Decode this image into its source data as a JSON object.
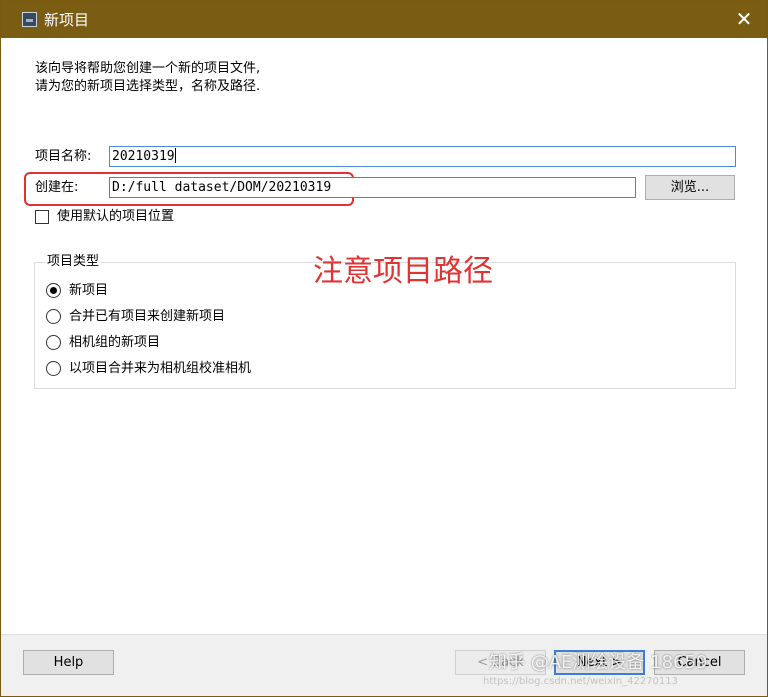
{
  "window": {
    "title": "新项目",
    "close_glyph": "✕"
  },
  "intro": {
    "text": "该向导将帮助您创建一个新的项目文件,\n请为您的新项目选择类型，名称及路径."
  },
  "form": {
    "name_label": "项目名称:",
    "name_value": "20210319",
    "location_label": "创建在:",
    "location_value": "D:/full dataset/DOM/20210319",
    "browse_label": "浏览...",
    "default_location_label": "使用默认的项目位置",
    "default_location_checked": false
  },
  "project_type": {
    "group_title": "项目类型",
    "options": [
      {
        "label": "新项目",
        "checked": true
      },
      {
        "label": "合并已有项目来创建新项目",
        "checked": false
      },
      {
        "label": "相机组的新项目",
        "checked": false
      },
      {
        "label": "以项目合并来为相机组校准相机",
        "checked": false
      }
    ]
  },
  "annotation": {
    "text": "注意项目路径",
    "color": "#e03434"
  },
  "footer": {
    "help_label": "Help",
    "back_label": "< Back",
    "next_label": "Next >",
    "cancel_label": "Cancel"
  },
  "watermark": {
    "text": "知乎 @AE测绘设备 18659",
    "url": "https://blog.csdn.net/weixin_42270113"
  },
  "colors": {
    "titlebar": "#7a5c12",
    "highlight": "#e53030",
    "focus": "#4a8ad6"
  }
}
